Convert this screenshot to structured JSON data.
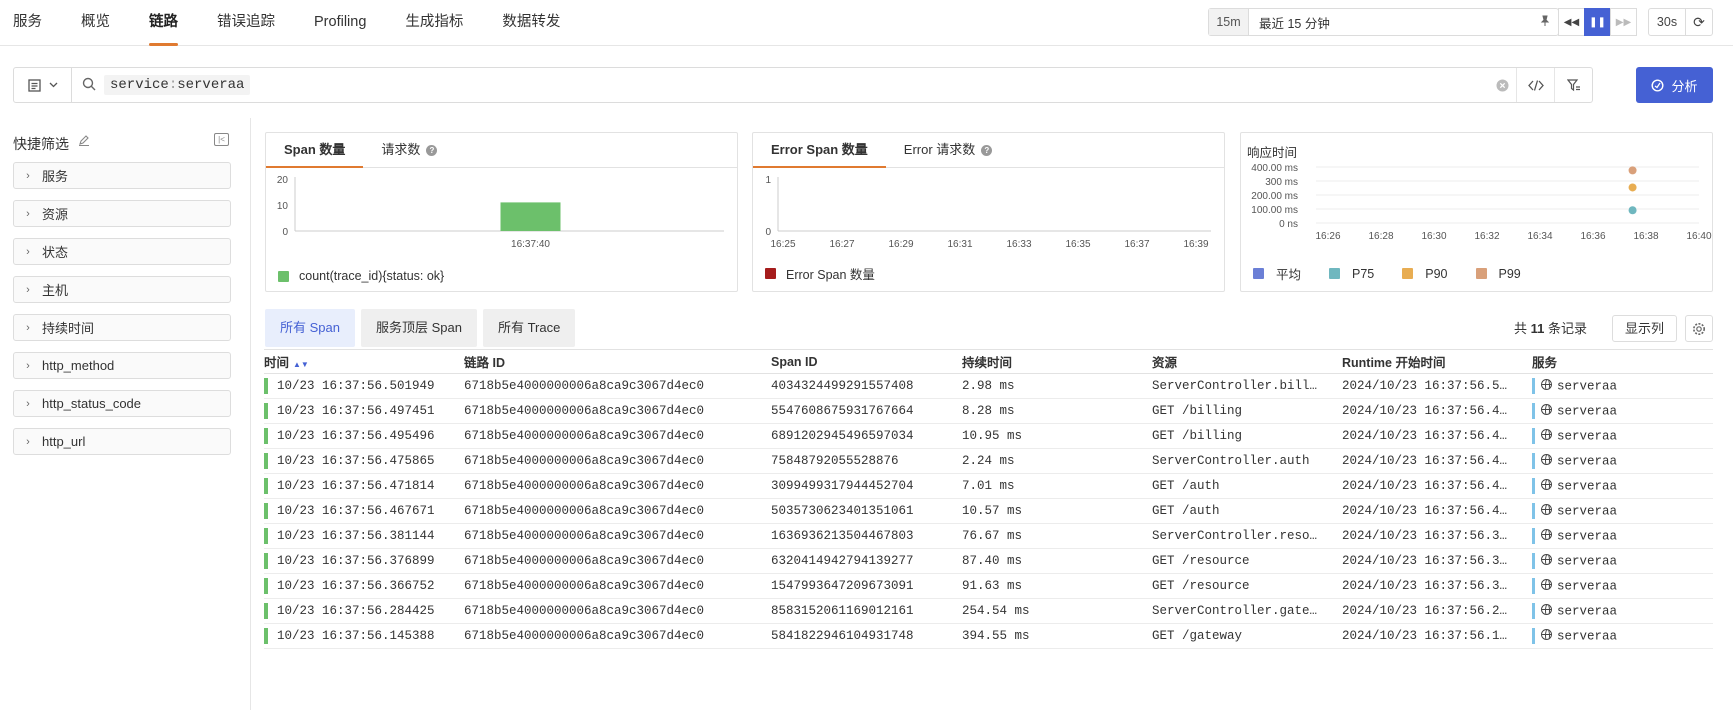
{
  "nav": {
    "items": [
      "服务",
      "概览",
      "链路",
      "错误追踪",
      "Profiling",
      "生成指标",
      "数据转发"
    ],
    "active_index": 2
  },
  "time": {
    "short": "15m",
    "label": "最近 15 分钟",
    "refresh_interval": "30s"
  },
  "search": {
    "query_key": "service",
    "query_value": "serveraa",
    "analyze_label": "分析"
  },
  "sidebar": {
    "title": "快捷筛选",
    "facets": [
      "服务",
      "资源",
      "状态",
      "主机",
      "持续时间",
      "http_method",
      "http_status_code",
      "http_url"
    ]
  },
  "chart1": {
    "tabs": [
      "Span 数量",
      "请求数"
    ],
    "legend": "count(trace_id){status: ok}",
    "legend_color": "#6cc06b"
  },
  "chart2": {
    "tabs": [
      "Error Span 数量",
      "Error 请求数"
    ],
    "legend": "Error Span 数量",
    "legend_color": "#a51c1c"
  },
  "chart3": {
    "title": "响应时间",
    "legend": [
      {
        "name": "平均",
        "color": "#6b7fd6"
      },
      {
        "name": "P75",
        "color": "#6fb7bf"
      },
      {
        "name": "P90",
        "color": "#e8ad52"
      },
      {
        "name": "P99",
        "color": "#d9a07a"
      }
    ]
  },
  "chart_data": [
    {
      "type": "bar",
      "categories": [
        "16:37:40"
      ],
      "values": [
        11
      ],
      "yticks": [
        "0",
        "10",
        "20"
      ],
      "ylim": [
        0,
        20
      ],
      "series": [
        {
          "name": "count(trace_id){status: ok}",
          "values": [
            11
          ]
        }
      ]
    },
    {
      "type": "bar",
      "x_ticks": [
        "16:25",
        "16:27",
        "16:29",
        "16:31",
        "16:33",
        "16:35",
        "16:37",
        "16:39"
      ],
      "yticks": [
        "0",
        "1"
      ],
      "ylim": [
        0,
        1
      ],
      "series": [
        {
          "name": "Error Span 数量",
          "values": []
        }
      ]
    },
    {
      "type": "scatter",
      "x_ticks": [
        "16:26",
        "16:28",
        "16:30",
        "16:32",
        "16:34",
        "16:36",
        "16:38",
        "16:40"
      ],
      "yticks": [
        "0 ns",
        "100.00 ms",
        "200.00 ms",
        "300 ms",
        "400.00 ms"
      ],
      "ylim_ms": [
        0,
        400
      ],
      "x": "16:37:40",
      "series": [
        {
          "name": "平均",
          "values": [
            59
          ]
        },
        {
          "name": "P75",
          "values": [
            91
          ]
        },
        {
          "name": "P90",
          "values": [
            254
          ]
        },
        {
          "name": "P99",
          "values": [
            376
          ]
        }
      ]
    }
  ],
  "table": {
    "view_tabs": [
      "所有 Span",
      "服务顶层 Span",
      "所有 Trace"
    ],
    "count_prefix": "共",
    "count": "11",
    "count_suffix": "条记录",
    "columns_button": "显示列",
    "headers": [
      "时间",
      "链路 ID",
      "Span ID",
      "持续时间",
      "资源",
      "Runtime 开始时间",
      "服务"
    ],
    "rows": [
      [
        "10/23 16:37:56.501949",
        "6718b5e4000000006a8ca9c3067d4ec0",
        "4034324499291557408",
        "2.98 ms",
        "ServerController.bill…",
        "2024/10/23 16:37:56.5…",
        "serveraa"
      ],
      [
        "10/23 16:37:56.497451",
        "6718b5e4000000006a8ca9c3067d4ec0",
        "5547608675931767664",
        "8.28 ms",
        "GET /billing",
        "2024/10/23 16:37:56.4…",
        "serveraa"
      ],
      [
        "10/23 16:37:56.495496",
        "6718b5e4000000006a8ca9c3067d4ec0",
        "6891202945496597034",
        "10.95 ms",
        "GET /billing",
        "2024/10/23 16:37:56.4…",
        "serveraa"
      ],
      [
        "10/23 16:37:56.475865",
        "6718b5e4000000006a8ca9c3067d4ec0",
        "75848792055528876",
        "2.24 ms",
        "ServerController.auth",
        "2024/10/23 16:37:56.4…",
        "serveraa"
      ],
      [
        "10/23 16:37:56.471814",
        "6718b5e4000000006a8ca9c3067d4ec0",
        "3099499317944452704",
        "7.01 ms",
        "GET /auth",
        "2024/10/23 16:37:56.4…",
        "serveraa"
      ],
      [
        "10/23 16:37:56.467671",
        "6718b5e4000000006a8ca9c3067d4ec0",
        "5035730623401351061",
        "10.57 ms",
        "GET /auth",
        "2024/10/23 16:37:56.4…",
        "serveraa"
      ],
      [
        "10/23 16:37:56.381144",
        "6718b5e4000000006a8ca9c3067d4ec0",
        "1636936213504467803",
        "76.67 ms",
        "ServerController.reso…",
        "2024/10/23 16:37:56.3…",
        "serveraa"
      ],
      [
        "10/23 16:37:56.376899",
        "6718b5e4000000006a8ca9c3067d4ec0",
        "6320414942794139277",
        "87.40 ms",
        "GET /resource",
        "2024/10/23 16:37:56.3…",
        "serveraa"
      ],
      [
        "10/23 16:37:56.366752",
        "6718b5e4000000006a8ca9c3067d4ec0",
        "1547993647209673091",
        "91.63 ms",
        "GET /resource",
        "2024/10/23 16:37:56.3…",
        "serveraa"
      ],
      [
        "10/23 16:37:56.284425",
        "6718b5e4000000006a8ca9c3067d4ec0",
        "8583152061169012161",
        "254.54 ms",
        "ServerController.gate…",
        "2024/10/23 16:37:56.2…",
        "serveraa"
      ],
      [
        "10/23 16:37:56.145388",
        "6718b5e4000000006a8ca9c3067d4ec0",
        "5841822946104931748",
        "394.55 ms",
        "GET /gateway",
        "2024/10/23 16:37:56.1…",
        "serveraa"
      ]
    ]
  }
}
